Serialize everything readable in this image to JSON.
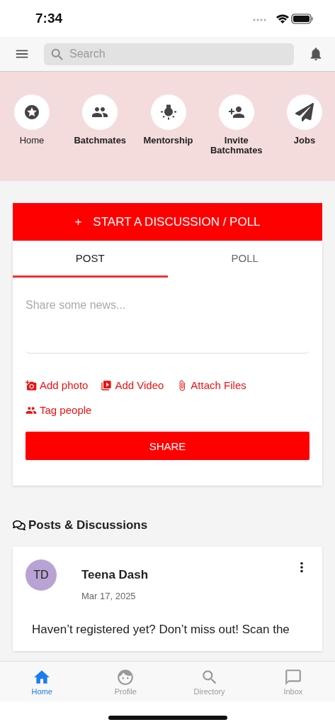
{
  "status_bar": {
    "time": "7:34"
  },
  "header": {
    "search": {
      "placeholder": "Search"
    }
  },
  "shortcuts": [
    {
      "label": "Home",
      "kind": "star"
    },
    {
      "label": "Batchmates",
      "kind": "group"
    },
    {
      "label": "Mentorship",
      "kind": "bulb"
    },
    {
      "label": "Invite Batchmates",
      "kind": "person-add"
    },
    {
      "label": "Jobs",
      "kind": "plane"
    }
  ],
  "composer": {
    "start_button": {
      "icon": "+",
      "label": "START A DISCUSSION / POLL"
    },
    "tabs": [
      {
        "label": "POST",
        "selected": true
      },
      {
        "label": "POLL",
        "selected": false
      }
    ],
    "input": {
      "placeholder": "Share some news..."
    },
    "actions": [
      {
        "label": "Add photo",
        "kind": "photo"
      },
      {
        "label": "Add Video",
        "kind": "video"
      },
      {
        "label": "Attach Files",
        "kind": "attach"
      },
      {
        "label": "Tag people",
        "kind": "people"
      }
    ],
    "share_button": "SHARE"
  },
  "section_title": "Posts & Discussions",
  "posts": [
    {
      "initials": "TD",
      "author": "Teena Dash",
      "date": "Mar 17, 2025",
      "body": "Haven’t registered yet? Don’t miss out! Scan the"
    }
  ],
  "tab_bar": [
    {
      "label": "Home",
      "kind": "home",
      "selected": true
    },
    {
      "label": "Profile",
      "kind": "face",
      "selected": false
    },
    {
      "label": "Directory",
      "kind": "search",
      "selected": false
    },
    {
      "label": "Inbox",
      "kind": "chat",
      "selected": false
    }
  ]
}
